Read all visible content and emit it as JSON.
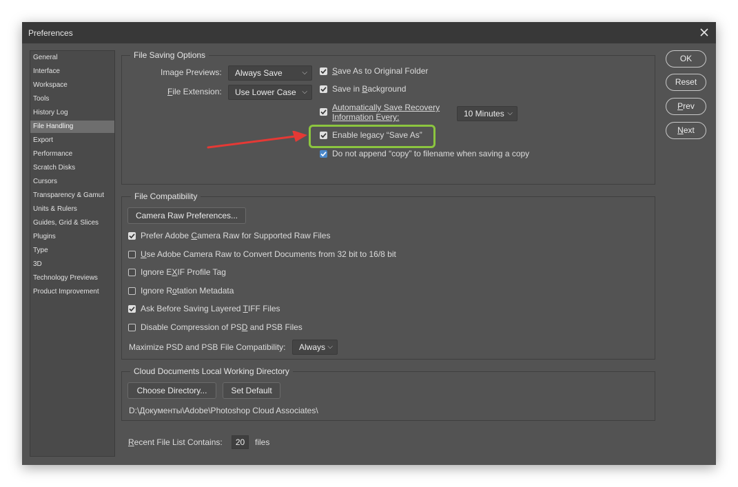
{
  "window": {
    "title": "Preferences"
  },
  "sidebar": {
    "items": [
      {
        "label": "General"
      },
      {
        "label": "Interface"
      },
      {
        "label": "Workspace"
      },
      {
        "label": "Tools"
      },
      {
        "label": "History Log"
      },
      {
        "label": "File Handling",
        "selected": true
      },
      {
        "label": "Export"
      },
      {
        "label": "Performance"
      },
      {
        "label": "Scratch Disks"
      },
      {
        "label": "Cursors"
      },
      {
        "label": "Transparency & Gamut"
      },
      {
        "label": "Units & Rulers"
      },
      {
        "label": "Guides, Grid & Slices"
      },
      {
        "label": "Plugins"
      },
      {
        "label": "Type"
      },
      {
        "label": "3D"
      },
      {
        "label": "Technology Previews"
      },
      {
        "label": "Product Improvement"
      }
    ]
  },
  "buttons": {
    "ok": "OK",
    "reset": "Reset",
    "prev_pre": "",
    "prev_u": "P",
    "prev_post": "rev",
    "next_pre": "",
    "next_u": "N",
    "next_post": "ext"
  },
  "file_saving": {
    "legend": "File Saving Options",
    "image_previews_label_pre": "Ima",
    "image_previews_label_u": "g",
    "image_previews_label_post": "e Previews:",
    "image_previews_value": "Always Save",
    "file_extension_label_u": "F",
    "file_extension_label_post": "ile Extension:",
    "file_extension_value": "Use Lower Case",
    "save_as_original_u": "S",
    "save_as_original_post": "ave As to Original Folder",
    "save_in_background_pre": "Save in ",
    "save_in_background_u": "B",
    "save_in_background_post": "ackground",
    "auto_save_line1": "Automatically Save Recovery",
    "auto_save_line2": "Information Every:",
    "auto_save_interval": "10 Minutes",
    "enable_legacy": "Enable legacy “Save As”",
    "do_not_append": "Do not append “copy” to filename when saving a copy"
  },
  "file_compat": {
    "legend": "File Compatibility",
    "camera_raw_button": "Camera Raw Preferences...",
    "prefer_acr_pre": "Prefer Adobe ",
    "prefer_acr_u": "C",
    "prefer_acr_post": "amera Raw for Supported Raw Files",
    "use_acr_u": "U",
    "use_acr_post": "se Adobe Camera Raw to Convert Documents from 32 bit to 16/8 bit",
    "ignore_exif_pre": "Ignore E",
    "ignore_exif_u": "X",
    "ignore_exif_post": "IF Profile Tag",
    "ignore_rotation_pre": "Ignore R",
    "ignore_rotation_u": "o",
    "ignore_rotation_post": "tation Metadata",
    "ask_tiff_pre": "Ask Before Saving Layered ",
    "ask_tiff_u": "T",
    "ask_tiff_post": "IFF Files",
    "disable_compression_pre": "Disable Compression of PS",
    "disable_compression_u": "D",
    "disable_compression_post": " and PSB Files",
    "maximize_label": "Maximize PSD and PSB File Compatibility:",
    "maximize_value": "Always"
  },
  "cloud": {
    "legend": "Cloud Documents Local Working Directory",
    "choose_directory": "Choose Directory...",
    "set_default": "Set Default",
    "path": "D:\\Документы\\Adobe\\Photoshop Cloud Associates\\"
  },
  "recent": {
    "label_u": "R",
    "label_post": "ecent File List Contains:",
    "value": "20",
    "suffix": "files"
  },
  "colors": {
    "highlight": "#8cc63f",
    "arrow": "#e53935",
    "checkbox_accent": "#4a87c9"
  },
  "icons": {
    "close": "close-icon",
    "check": "checkmark-icon",
    "chevron": "chevron-down-icon"
  }
}
